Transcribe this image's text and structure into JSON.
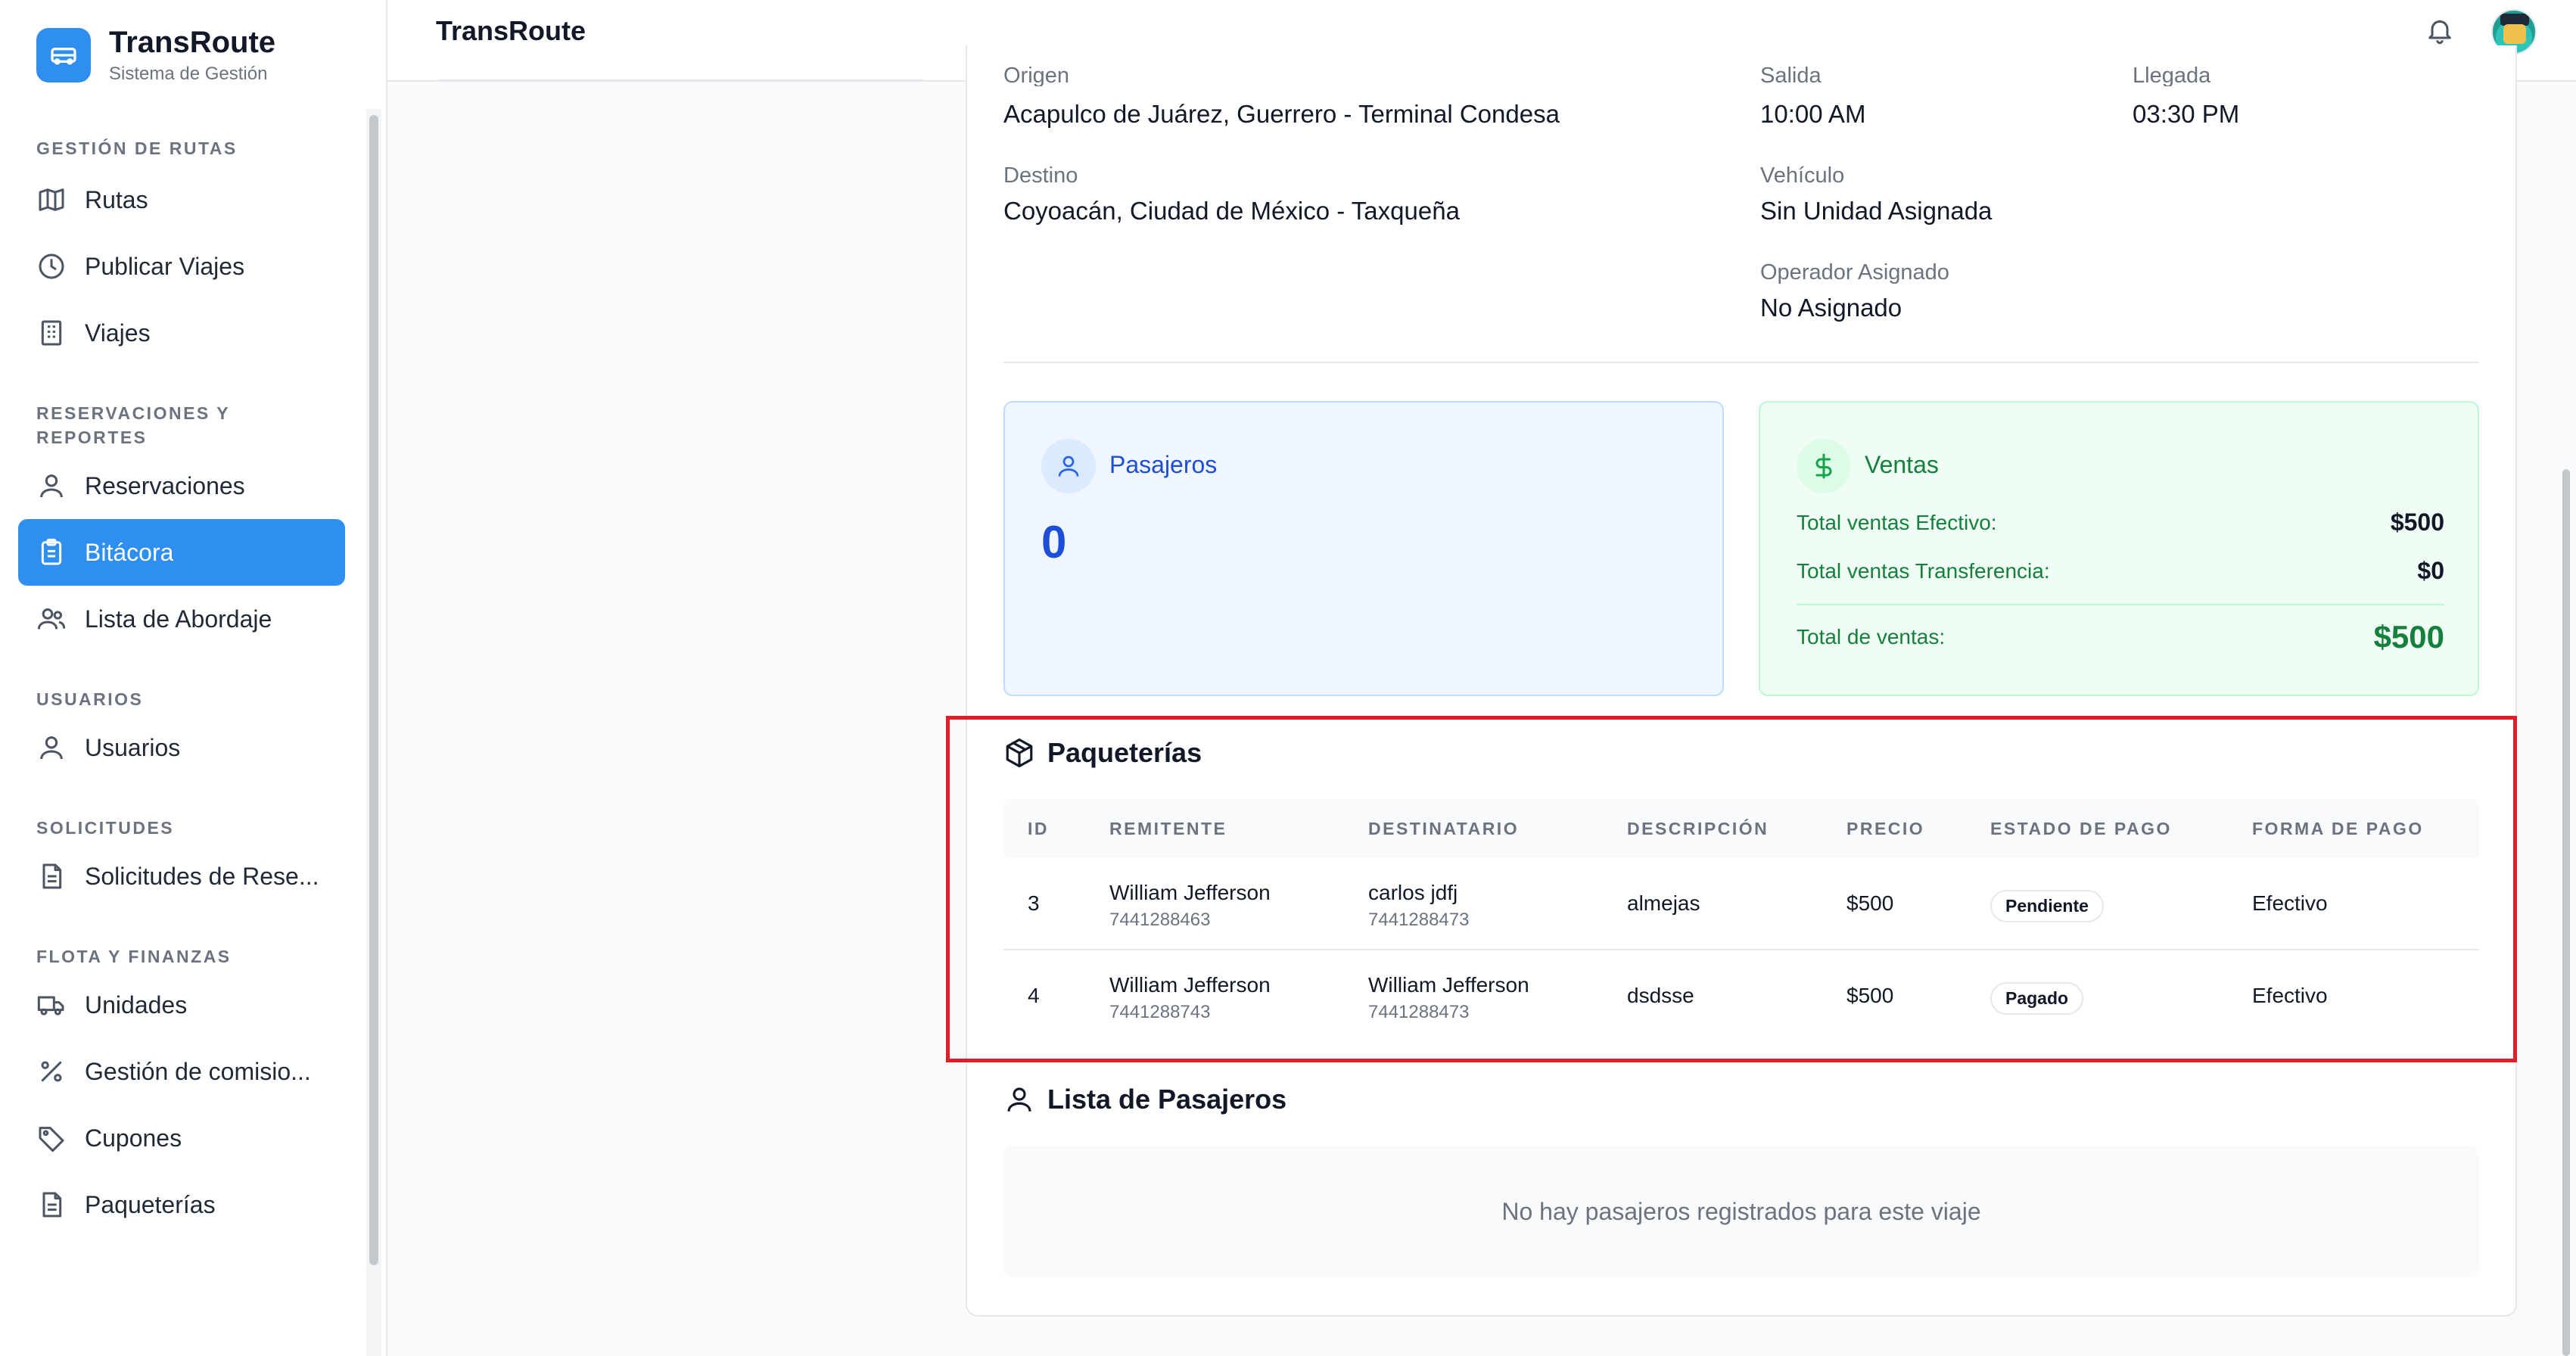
{
  "app": {
    "name": "TransRoute",
    "subtitle": "Sistema de Gestión"
  },
  "header": {
    "title": "TransRoute"
  },
  "sidebar": {
    "sections": [
      {
        "title": "GESTIÓN DE RUTAS",
        "items": [
          {
            "label": "Rutas",
            "icon": "map-icon"
          },
          {
            "label": "Publicar Viajes",
            "icon": "clock-icon"
          },
          {
            "label": "Viajes",
            "icon": "building-icon"
          }
        ]
      },
      {
        "title": "RESERVACIONES Y REPORTES",
        "items": [
          {
            "label": "Reservaciones",
            "icon": "user-icon"
          },
          {
            "label": "Bitácora",
            "icon": "clipboard-icon",
            "active": true
          },
          {
            "label": "Lista de Abordaje",
            "icon": "users-icon"
          }
        ]
      },
      {
        "title": "USUARIOS",
        "items": [
          {
            "label": "Usuarios",
            "icon": "user-icon"
          }
        ]
      },
      {
        "title": "SOLICITUDES",
        "items": [
          {
            "label": "Solicitudes de Rese...",
            "icon": "file-icon"
          }
        ]
      },
      {
        "title": "FLOTA Y FINANZAS",
        "items": [
          {
            "label": "Unidades",
            "icon": "truck-icon"
          },
          {
            "label": "Gestión de comisio...",
            "icon": "percent-icon"
          },
          {
            "label": "Cupones",
            "icon": "tag-icon"
          },
          {
            "label": "Paqueterías",
            "icon": "file-icon"
          }
        ]
      }
    ]
  },
  "trip": {
    "origin_label": "Origen",
    "origin": "Acapulco de Juárez, Guerrero - Terminal Condesa",
    "departure_label": "Salida",
    "departure": "10:00 AM",
    "arrival_label": "Llegada",
    "arrival": "03:30 PM",
    "destination_label": "Destino",
    "destination": "Coyoacán, Ciudad de México - Taxqueña",
    "vehicle_label": "Vehículo",
    "vehicle": "Sin Unidad Asignada",
    "operator_label": "Operador Asignado",
    "operator": "No Asignado"
  },
  "stats": {
    "passengers_title": "Pasajeros",
    "passengers_count": "0",
    "sales_title": "Ventas",
    "cash_label": "Total ventas Efectivo:",
    "cash_value": "$500",
    "transfer_label": "Total ventas Transferencia:",
    "transfer_value": "$0",
    "total_label": "Total de ventas:",
    "total_value": "$500"
  },
  "packages": {
    "title": "Paqueterías",
    "columns": [
      "ID",
      "REMITENTE",
      "DESTINATARIO",
      "DESCRIPCIÓN",
      "PRECIO",
      "ESTADO DE PAGO",
      "FORMA DE PAGO"
    ],
    "rows": [
      {
        "id": "3",
        "sender": "William Jefferson",
        "sender_phone": "7441288463",
        "recipient": "carlos jdfj",
        "recipient_phone": "7441288473",
        "description": "almejas",
        "price": "$500",
        "status": "Pendiente",
        "payment": "Efectivo"
      },
      {
        "id": "4",
        "sender": "William Jefferson",
        "sender_phone": "7441288743",
        "recipient": "William Jefferson",
        "recipient_phone": "7441288473",
        "description": "dsdsse",
        "price": "$500",
        "status": "Pagado",
        "payment": "Efectivo"
      }
    ]
  },
  "passengers": {
    "title": "Lista de Pasajeros",
    "empty_text": "No hay pasajeros registrados para este viaje"
  },
  "colors": {
    "accent": "#2f8ff0",
    "highlight": "#e11d2a",
    "sales_green": "#15803d",
    "pax_blue": "#1d4ed8"
  }
}
